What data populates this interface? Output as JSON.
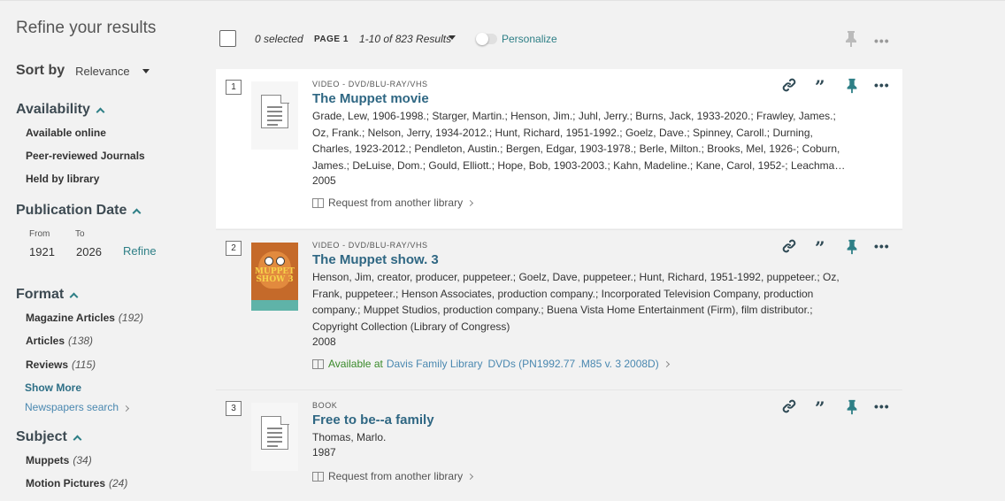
{
  "sidebar": {
    "title": "Refine your results",
    "sort_label": "Sort by",
    "sort_value": "Relevance",
    "availability": {
      "heading": "Availability",
      "items": [
        "Available online",
        "Peer-reviewed Journals",
        "Held by library"
      ]
    },
    "pubdate": {
      "heading": "Publication Date",
      "from_label": "From",
      "to_label": "To",
      "from_value": "1921",
      "to_value": "2026",
      "refine_label": "Refine"
    },
    "format": {
      "heading": "Format",
      "items": [
        {
          "label": "Magazine Articles",
          "count": "(192)"
        },
        {
          "label": "Articles",
          "count": "(138)"
        },
        {
          "label": "Reviews",
          "count": "(115)"
        }
      ],
      "show_more": "Show More",
      "newspapers": "Newspapers search"
    },
    "subject": {
      "heading": "Subject",
      "items": [
        {
          "label": "Muppets",
          "count": "(34)"
        },
        {
          "label": "Motion Pictures",
          "count": "(24)"
        }
      ]
    }
  },
  "toolbar": {
    "selected": "0 selected",
    "page": "PAGE 1",
    "results": "1-10 of 823 Results",
    "personalize": "Personalize",
    "more": "•••"
  },
  "results": [
    {
      "num": "1",
      "type": "VIDEO - DVD/BLU-RAY/VHS",
      "title": "The Muppet movie",
      "creators": "Grade, Lew, 1906-1998.; Starger, Martin.; Henson, Jim.; Juhl, Jerry.; Burns, Jack, 1933-2020.; Frawley, James.; Oz, Frank.; Nelson, Jerry, 1934-2012.; Hunt, Richard, 1951-1992.; Goelz, Dave.; Spinney, Caroll.; Durning, Charles, 1923-2012.; Pendleton, Austin.; Bergen, Edgar, 1903-1978.; Berle, Milton.; Brooks, Mel, 1926-; Coburn, James.; DeLuise, Dom.; Gould, Elliott.; Hope, Bob, 1903-2003.; Kahn, Madeline.; Kane, Carol, 1952-; Leachma…",
      "year": "2005",
      "availability": "Request from another library"
    },
    {
      "num": "2",
      "type": "VIDEO - DVD/BLU-RAY/VHS",
      "title": "The Muppet show. 3",
      "creators": "Henson, Jim, creator, producer, puppeteer.; Goelz, Dave, puppeteer.; Hunt, Richard, 1951-1992, puppeteer.; Oz, Frank, puppeteer.; Henson Associates, production company.; Incorporated Television Company, production company.; Muppet Studios, production company.; Buena Vista Home Entertainment (Firm), film distributor.; Copyright Collection (Library of Congress)",
      "year": "2008",
      "availability": "Available at",
      "location": "Davis Family Library",
      "shelf": "DVDs (PN1992.77 .M85 v. 3 2008D)",
      "cover_text": "MUPPET SHOW 3"
    },
    {
      "num": "3",
      "type": "BOOK",
      "title": "Free to be--a family",
      "creators": "Thomas, Marlo.",
      "year": "1987",
      "availability": "Request from another library"
    }
  ],
  "colors": {
    "accent": "#2e7f86",
    "title_link": "#2f6783",
    "available_green": "#3a8a2a",
    "location_link": "#4a88b0"
  },
  "icons": {
    "actions": [
      "link-icon",
      "quote-icon",
      "pin-icon",
      "more-icon"
    ]
  }
}
